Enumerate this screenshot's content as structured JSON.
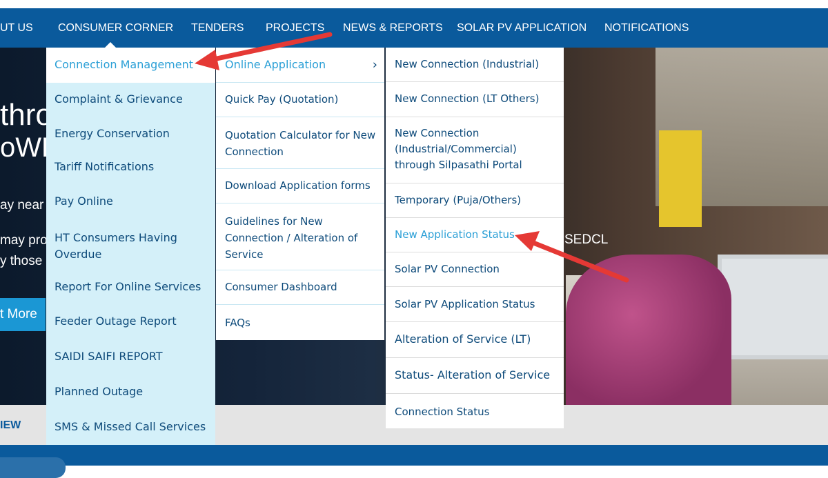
{
  "nav": {
    "items": [
      "UT US",
      "CONSUMER CORNER",
      "TENDERS",
      "PROJECTS",
      "NEWS & REPORTS",
      "SOLAR PV APPLICATION",
      "NOTIFICATIONS"
    ]
  },
  "hero": {
    "text_lines": [
      "thro",
      "oWE",
      "ay near",
      "may pro",
      "y those"
    ],
    "button_label": "t More",
    "side_text": "SEDCL"
  },
  "section_label": "IEW",
  "menu_level1": [
    "Connection Management",
    "Complaint & Grievance",
    "Energy Conservation",
    "Tariff Notifications",
    "Pay Online",
    "HT Consumers Having Overdue",
    "Report For Online Services",
    "Feeder Outage Report",
    "SAIDI SAIFI REPORT",
    "Planned Outage",
    "SMS & Missed Call Services"
  ],
  "menu_level2": [
    "Online Application",
    "Quick Pay (Quotation)",
    "Quotation Calculator for New Connection",
    "Download Application forms",
    "Guidelines for New Connection / Alteration of Service",
    "Consumer Dashboard",
    "FAQs"
  ],
  "menu_level3": [
    "New Connection (Industrial)",
    "New Connection (LT Others)",
    "New Connection (Industrial/Commercial) through Silpasathi Portal",
    "Temporary (Puja/Others)",
    "New Application Status",
    "Solar PV Connection",
    "Solar PV Application Status",
    "Alteration of Service (LT)",
    "Status- Alteration of Service",
    "Connection Status"
  ],
  "icons": {
    "submenu_chevron": "chevron-right-icon"
  },
  "colors": {
    "nav_bg": "#0a5a9c",
    "menu_l1_bg": "#d4f0f9",
    "active_text": "#2a9fd6",
    "menu_text": "#0d4a7a",
    "annotation_arrow": "#e53935"
  }
}
